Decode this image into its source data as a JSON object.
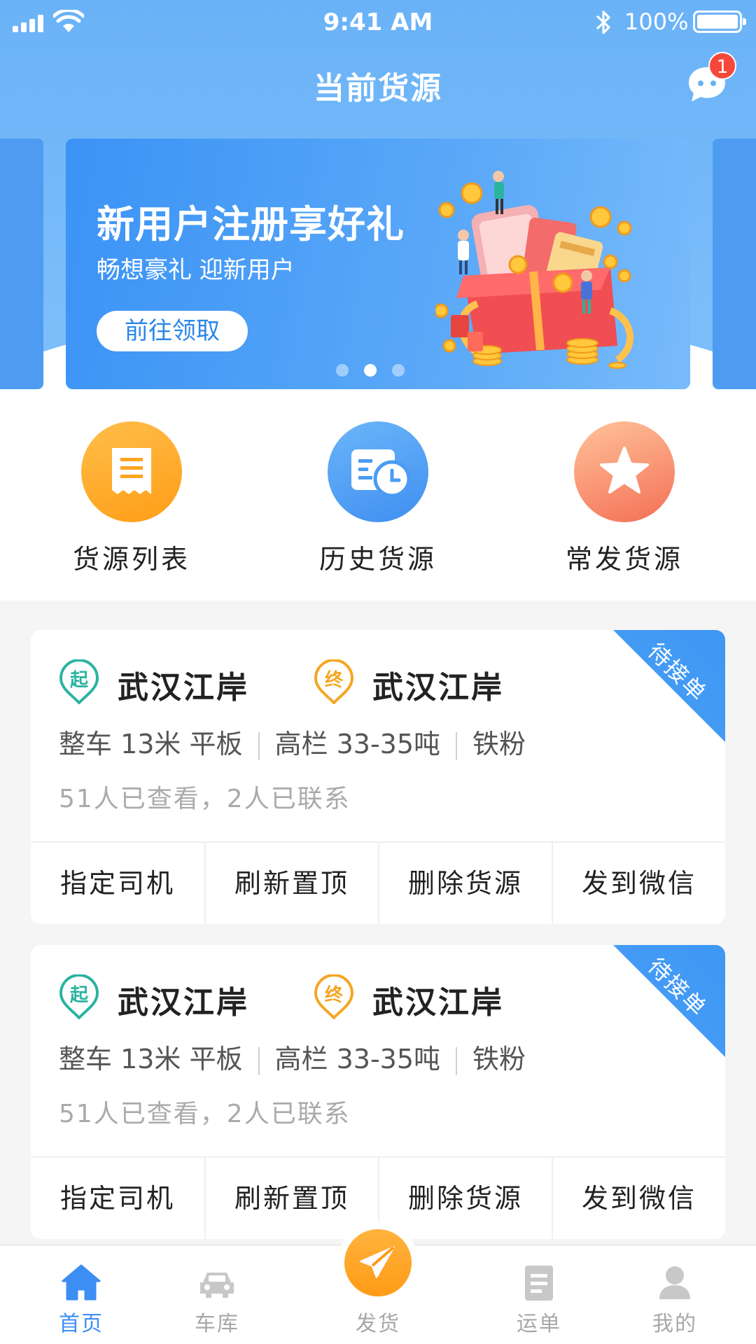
{
  "status_bar": {
    "time": "9:41 AM",
    "battery": "100%"
  },
  "header": {
    "title": "当前货源",
    "message_badge": "1"
  },
  "banner": {
    "title": "新用户注册享好礼",
    "subtitle": "畅想豪礼 迎新用户",
    "cta": "前往领取",
    "page_count": 3,
    "active_page": 2
  },
  "quick_actions": [
    {
      "label": "货源列表",
      "icon": "receipt-icon",
      "color": "#ffa41f"
    },
    {
      "label": "历史货源",
      "icon": "history-icon",
      "color": "#4a9bf4"
    },
    {
      "label": "常发货源",
      "icon": "star-icon",
      "color": "#f8805c"
    }
  ],
  "cards": [
    {
      "badge": "待接单",
      "origin_tag": "起",
      "origin": "武汉江岸",
      "dest_tag": "终",
      "destination": "武汉江岸",
      "spec_1": "整车 13米 平板",
      "spec_2": "高栏 33-35吨",
      "spec_3": "铁粉",
      "stats": "51人已查看，2人已联系",
      "actions": [
        "指定司机",
        "刷新置顶",
        "删除货源",
        "发到微信"
      ]
    },
    {
      "badge": "待接单",
      "origin_tag": "起",
      "origin": "武汉江岸",
      "dest_tag": "终",
      "destination": "武汉江岸",
      "spec_1": "整车 13米 平板",
      "spec_2": "高栏 33-35吨",
      "spec_3": "铁粉",
      "stats": "51人已查看，2人已联系",
      "actions": [
        "指定司机",
        "刷新置顶",
        "删除货源",
        "发到微信"
      ]
    }
  ],
  "tabbar": {
    "items": [
      {
        "label": "首页",
        "icon": "home-icon",
        "active": true
      },
      {
        "label": "车库",
        "icon": "car-icon",
        "active": false
      },
      {
        "label": "发货",
        "icon": "send-icon",
        "active": false
      },
      {
        "label": "运单",
        "icon": "waybill-icon",
        "active": false
      },
      {
        "label": "我的",
        "icon": "profile-icon",
        "active": false
      }
    ]
  },
  "colors": {
    "primary": "#3d8ef3",
    "accent_orange": "#ff9b16",
    "origin_green": "#2bb3a0",
    "dest_orange": "#f5a623"
  }
}
